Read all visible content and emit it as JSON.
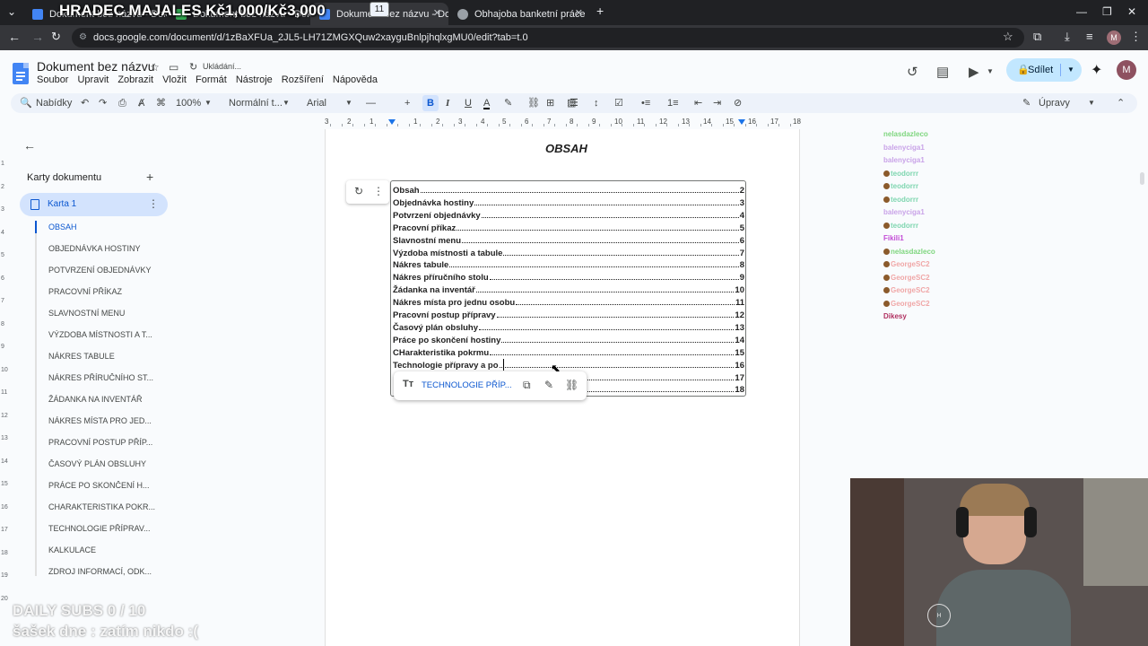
{
  "browser": {
    "tabs": [
      {
        "label": "Dokument bez názvu - Dokumenty Google",
        "favicon_color": "#4285f4"
      },
      {
        "label": "Dokument bez názvu - Dokumenty Google",
        "favicon_color": "#34a853"
      },
      {
        "label": "Dokument bez názvu - Dokum",
        "favicon_color": "#4285f4"
      },
      {
        "label": "Obhajoba banketní práce",
        "favicon_color": "#9aa0a6"
      }
    ],
    "url": "docs.google.com/document/d/1zBaXFUa_2JL5-LH71ZMGXQuw2xayguBnlpjhqlxgMU0/edit?tab=t.0",
    "profile_initial": "M"
  },
  "stream_title": "HRADEC MAJALES Kč1,000/Kč3,000",
  "docs": {
    "title": "Dokument bez názvu",
    "saving_status": "Ukládání...",
    "menu": [
      "Soubor",
      "Upravit",
      "Zobrazit",
      "Vložit",
      "Formát",
      "Nástroje",
      "Rozšíření",
      "Nápověda"
    ],
    "share_label": "Sdílet",
    "user_initial": "M"
  },
  "toolbar": {
    "search_label": "Nabídky",
    "zoom": "100%",
    "style": "Normální t...",
    "font": "Arial",
    "font_size": "11",
    "mode": "Úpravy"
  },
  "ruler": {
    "labels": [
      "3",
      "2",
      "1",
      "1",
      "2",
      "3",
      "4",
      "5",
      "6",
      "7",
      "8",
      "9",
      "10",
      "11",
      "12",
      "13",
      "14",
      "15",
      "16",
      "17",
      "18"
    ]
  },
  "vruler": {
    "labels": [
      "1",
      "2",
      "3",
      "4",
      "5",
      "6",
      "7",
      "8",
      "9",
      "10",
      "11",
      "12",
      "13",
      "14",
      "15",
      "16",
      "17",
      "18",
      "19",
      "20"
    ]
  },
  "sidebar": {
    "heading": "Karty dokumentu",
    "tab_label": "Karta 1",
    "outline": [
      "OBSAH",
      "OBJEDNÁVKA HOSTINY",
      "POTVRZENÍ OBJEDNÁVKY",
      "PRACOVNÍ PŘÍKAZ",
      "SLAVNOSTNÍ MENU",
      "VÝZDOBA MÍSTNOSTI A T...",
      "NÁKRES TABULE",
      "NÁKRES PŘÍRUČNÍHO ST...",
      "ŽÁDANKA NA INVENTÁŘ",
      "NÁKRES MÍSTA PRO JED...",
      "PRACOVNÍ POSTUP PŘÍP...",
      "ČASOVÝ PLÁN OBSLUHY",
      "PRÁCE PO SKONČENÍ H...",
      "CHARAKTERISTIKA POKR...",
      "TECHNOLOGIE PŘÍPRAV...",
      "KALKULACE",
      "ZDROJ INFORMACÍ, ODK..."
    ]
  },
  "page": {
    "heading": "OBSAH",
    "toc": [
      {
        "title": "Obsah",
        "page": "2"
      },
      {
        "title": "Objednávka hostiny",
        "page": "3"
      },
      {
        "title": "Potvrzení objednávky",
        "page": "4"
      },
      {
        "title": "Pracovní příkaz",
        "page": "5"
      },
      {
        "title": "Slavnostní menu ",
        "page": "6"
      },
      {
        "title": "Výzdoba místnosti a tabule",
        "page": "7"
      },
      {
        "title": "Nákres tabule",
        "page": "8"
      },
      {
        "title": "Nákres příručního stolu",
        "page": "9"
      },
      {
        "title": "Žádanka na inventář",
        "page": "10"
      },
      {
        "title": "Nákres místa pro jednu osobu",
        "page": "11"
      },
      {
        "title": "Pracovní postup přípravy",
        "page": "12"
      },
      {
        "title": "Časový plán obsluhy ",
        "page": "13"
      },
      {
        "title": "Práce po skončení hostiny",
        "page": "14"
      },
      {
        "title": "CHarakteristika pokrmu",
        "page": "15"
      },
      {
        "title": "Technologie přípravy a po",
        "page": "16"
      },
      {
        "title": "",
        "page": "17"
      },
      {
        "title": "",
        "page": "18"
      }
    ],
    "link_popup_text": "TECHNOLOGIE PŘÍP..."
  },
  "chat": [
    {
      "user": "nelasdazleco",
      "color": "#7fd67f",
      "badge": ""
    },
    {
      "user": "balenyciga1",
      "color": "#c9a3e8",
      "badge": ""
    },
    {
      "user": "balenyciga1",
      "color": "#c9a3e8",
      "badge": ""
    },
    {
      "user": "teodorrr",
      "color": "#7fd6b0",
      "badge": "#8b5a2b"
    },
    {
      "user": "teodorrr",
      "color": "#7fd6b0",
      "badge": "#8b5a2b"
    },
    {
      "user": "teodorrr",
      "color": "#7fd6b0",
      "badge": "#8b5a2b"
    },
    {
      "user": "balenyciga1",
      "color": "#c9a3e8",
      "badge": ""
    },
    {
      "user": "teodorrr",
      "color": "#7fd6b0",
      "badge": "#8b5a2b"
    },
    {
      "user": "Fikili1",
      "color": "#c24bd6",
      "badge": ""
    },
    {
      "user": "nelasdazleco",
      "color": "#7fd67f",
      "badge": "#8b5a2b"
    },
    {
      "user": "GeorgeSC2",
      "color": "#f0a7a7",
      "badge": "#8b5a2b"
    },
    {
      "user": "GeorgeSC2",
      "color": "#f0a7a7",
      "badge": "#8b5a2b"
    },
    {
      "user": "GeorgeSC2",
      "color": "#f0a7a7",
      "badge": "#8b5a2b"
    },
    {
      "user": "GeorgeSC2",
      "color": "#f0a7a7",
      "badge": "#8b5a2b"
    },
    {
      "user": "Dikesy",
      "color": "#b03060",
      "badge": ""
    }
  ],
  "overlay": {
    "subs_goal": "DAILY SUBS 0 / 10",
    "clown": "šašek dne : zatím nikdo :("
  }
}
